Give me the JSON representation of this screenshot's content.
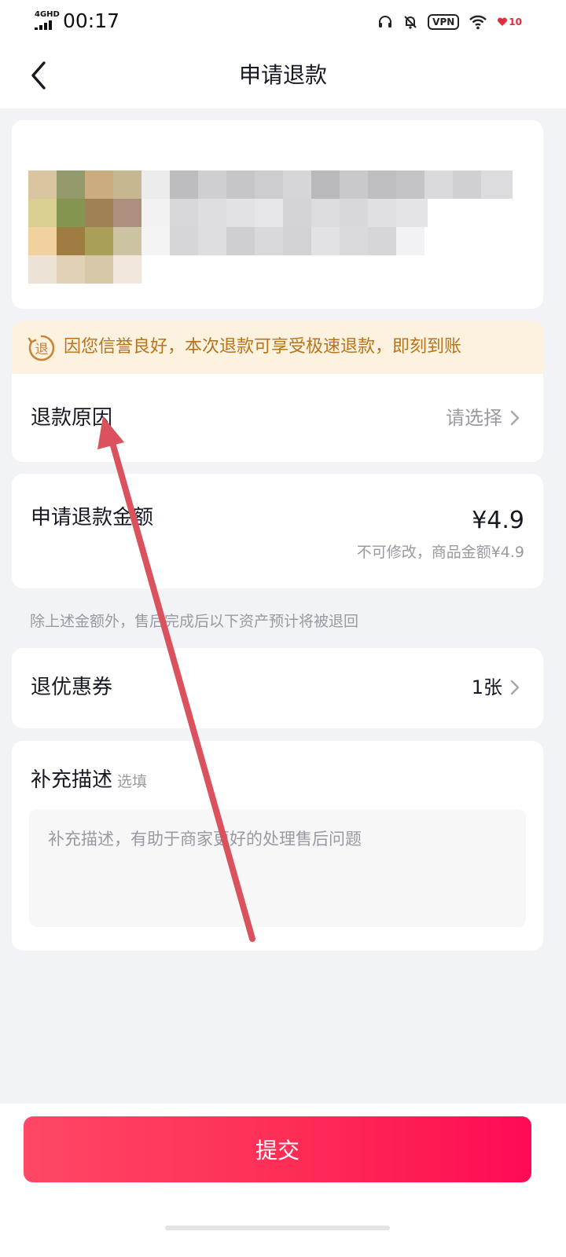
{
  "status_bar": {
    "network": "4GHD",
    "time": "00:17",
    "vpn_label": "VPN",
    "battery": "10"
  },
  "nav": {
    "title": "申请退款",
    "back_icon": "chevron-left-icon"
  },
  "banner": {
    "icon_text": "退",
    "text": "因您信誉良好，本次退款可享受极速退款，即刻到账"
  },
  "refund_reason": {
    "label": "退款原因",
    "placeholder": "请选择"
  },
  "refund_amount": {
    "label": "申请退款金额",
    "value": "¥4.9",
    "note": "不可修改，商品金额¥4.9"
  },
  "hint": "除上述金额外，售后完成后以下资产预计将被退回",
  "coupon": {
    "label": "退优惠券",
    "value": "1张"
  },
  "description": {
    "title": "补充描述",
    "optional": "选填",
    "placeholder": "补充描述，有助于商家更好的处理售后问题"
  },
  "submit_label": "提交",
  "colors": {
    "accent": "#fe2c55",
    "banner_bg": "#fdf1e0",
    "banner_text": "#b8741a",
    "annotation_arrow": "#d9525e"
  }
}
